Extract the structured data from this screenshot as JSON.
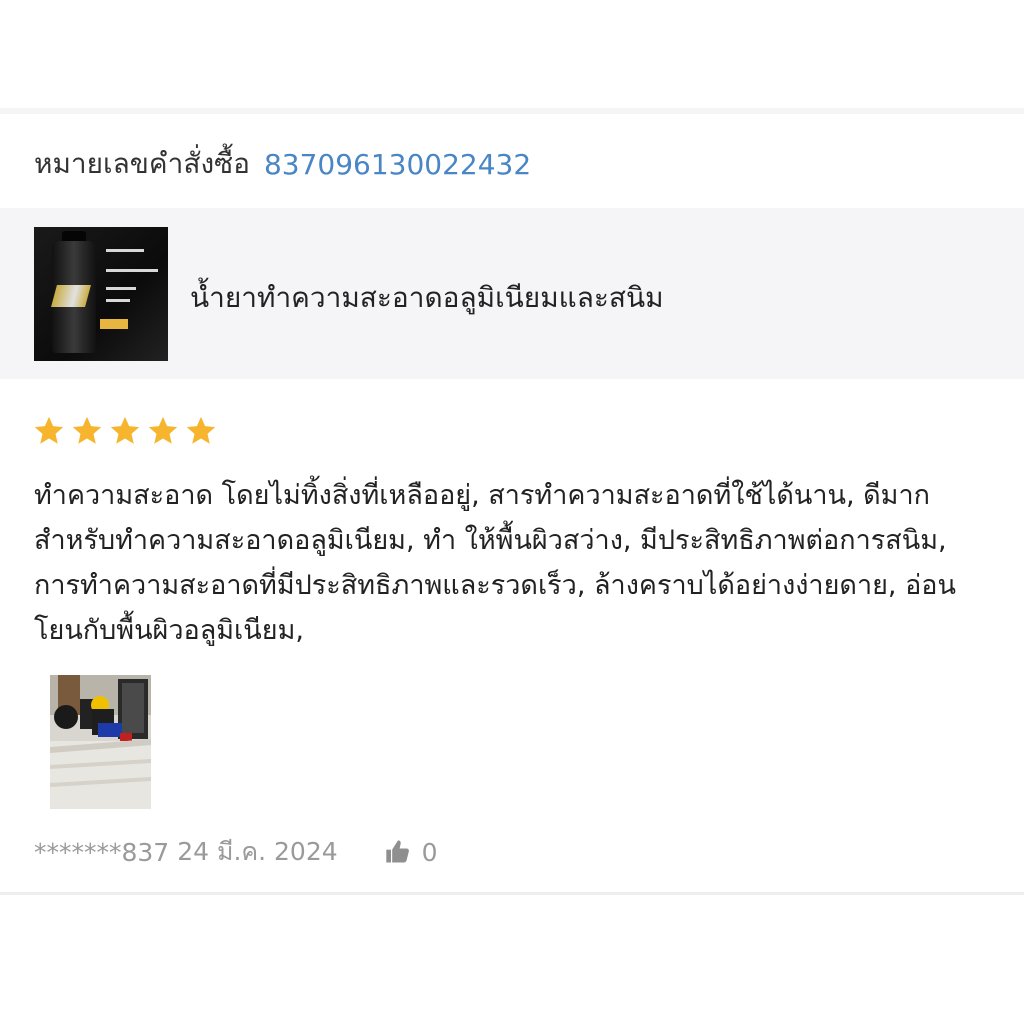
{
  "order": {
    "label": "หมายเลขคำสั่งซื้อ",
    "number": "837096130022432"
  },
  "product": {
    "name": "น้ำยาทำความสะอาดอลูมิเนียมและสนิม",
    "thumb_icon": "product-bottle-image"
  },
  "review": {
    "rating": 5,
    "rating_max": 5,
    "star_color": "#f6b52c",
    "text": "ทำความสะอาด โดยไม่ทิ้งสิ่งที่เหลืออยู่, สารทำความสะอาดที่ใช้ได้นาน, ดีมากสำหรับทำความสะอาดอลูมิเนียม, ทำ ให้พื้นผิวสว่าง, มีประสิทธิภาพต่อการสนิม, การทำความสะอาดที่มีประสิทธิภาพและรวดเร็ว, ล้างคราบได้อย่างง่ายดาย, อ่อนโยนกับพื้นผิวอลูมิเนียม,",
    "photo_icon": "review-photo-image"
  },
  "footer": {
    "user": "*******837",
    "date": "24 มี.ค. 2024",
    "like_icon": "thumbs-up-icon",
    "like_count": "0"
  },
  "colors": {
    "link": "#4a86c5",
    "band": "#f5f5f7",
    "muted": "#9a9a9a"
  }
}
